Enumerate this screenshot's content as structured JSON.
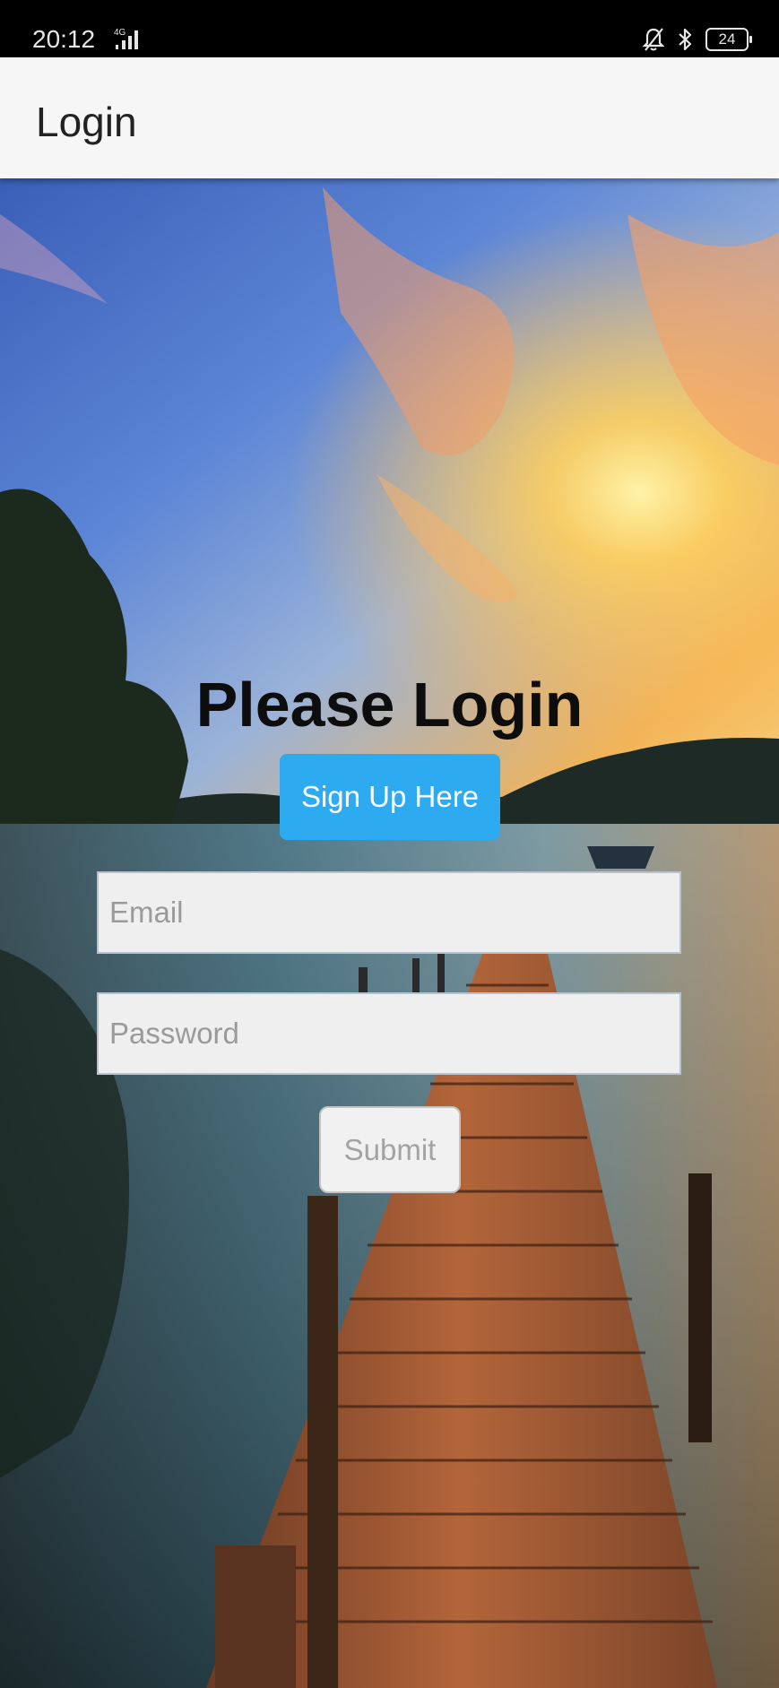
{
  "status_bar": {
    "time": "20:12",
    "network": "4G",
    "battery": "24"
  },
  "app_bar": {
    "title": "Login"
  },
  "login": {
    "heading": "Please Login",
    "signup_label": "Sign Up Here",
    "email_placeholder": "Email",
    "password_placeholder": "Password",
    "submit_label": "Submit"
  },
  "colors": {
    "signup_accent": "#2eaaf0",
    "appbar_bg": "#f6f6f6",
    "field_bg": "#efefef"
  },
  "icons": [
    "signal-icon",
    "mute-bell-icon",
    "bluetooth-icon",
    "battery-icon"
  ]
}
